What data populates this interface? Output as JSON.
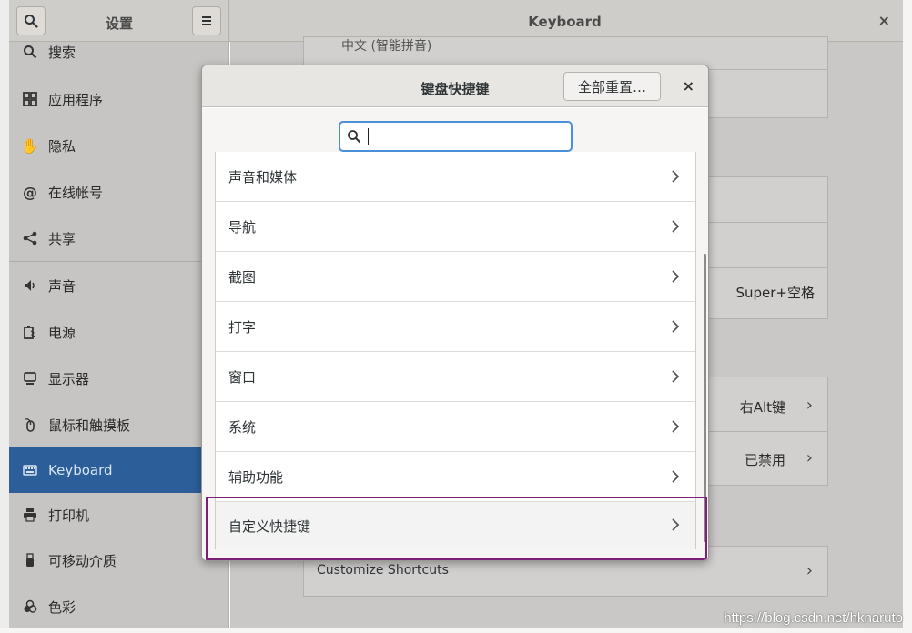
{
  "header": {
    "app_title": "设置",
    "panel_title": "Keyboard",
    "close": "×"
  },
  "sidebar": {
    "items": [
      {
        "label": "搜索",
        "icon": "search-icon"
      },
      {
        "label": "应用程序",
        "icon": "grid-icon"
      },
      {
        "label": "隐私",
        "icon": "hand-icon"
      },
      {
        "label": "在线帐号",
        "icon": "at-icon"
      },
      {
        "label": "共享",
        "icon": "share-icon"
      },
      {
        "label": "声音",
        "icon": "speaker-icon"
      },
      {
        "label": "电源",
        "icon": "battery-icon"
      },
      {
        "label": "显示器",
        "icon": "monitor-icon"
      },
      {
        "label": "鼠标和触摸板",
        "icon": "mouse-icon"
      },
      {
        "label": "Keyboard",
        "icon": "keyboard-icon",
        "active": true
      },
      {
        "label": "打印机",
        "icon": "printer-icon"
      },
      {
        "label": "可移动介质",
        "icon": "usb-icon"
      },
      {
        "label": "色彩",
        "icon": "color-icon"
      }
    ]
  },
  "main": {
    "input_source_peek": "中文 (智能拼音)",
    "switch_value": "Super+空格",
    "alt_key_value": "右Alt键",
    "compose_value": "已禁用",
    "customize_shortcuts": "Customize Shortcuts"
  },
  "dialog": {
    "title": "键盘快捷键",
    "reset_label": "全部重置…",
    "close": "×",
    "search_placeholder": "",
    "rows": [
      {
        "label": "声音和媒体"
      },
      {
        "label": "导航"
      },
      {
        "label": "截图"
      },
      {
        "label": "打字"
      },
      {
        "label": "窗口"
      },
      {
        "label": "系统"
      },
      {
        "label": "辅助功能"
      },
      {
        "label": "自定义快捷键"
      }
    ]
  },
  "watermark": "https://blog.csdn.net/hknaruto",
  "colors": {
    "accent": "#2c5f99",
    "highlight_border": "#7a1f7a",
    "focus_ring": "#4a90d9"
  }
}
